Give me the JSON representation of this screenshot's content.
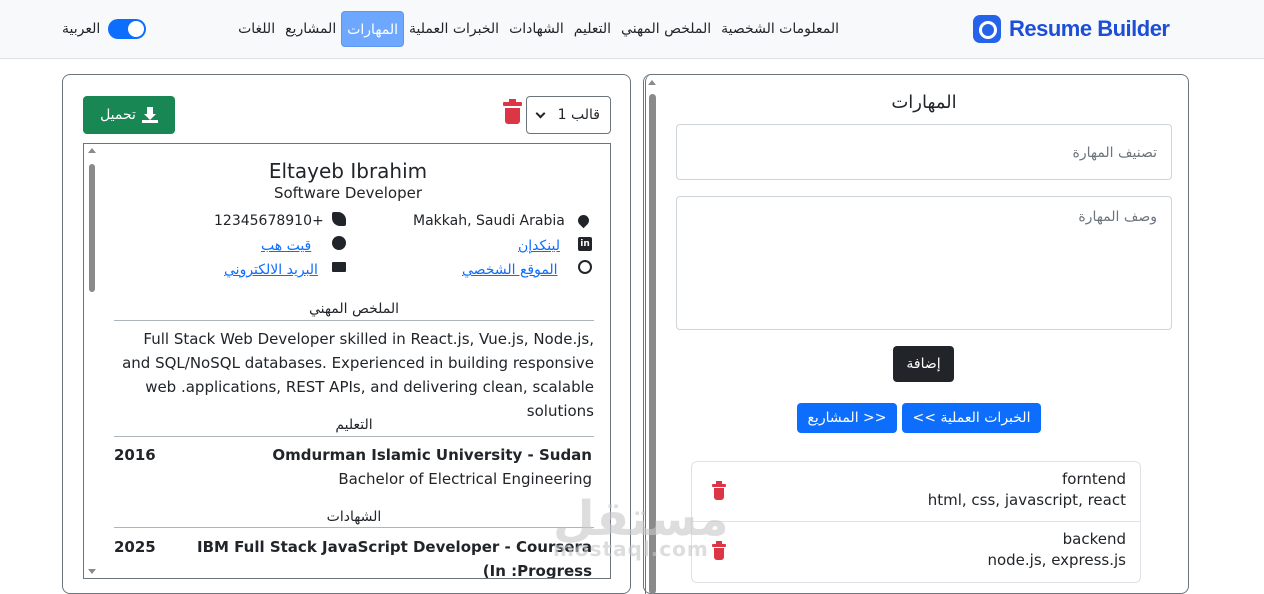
{
  "navbar": {
    "brand": "Resume Builder",
    "links": [
      {
        "label": "المعلومات الشخصية",
        "active": false
      },
      {
        "label": "الملخص المهني",
        "active": false
      },
      {
        "label": "التعليم",
        "active": false
      },
      {
        "label": "الشهادات",
        "active": false
      },
      {
        "label": "الخبرات العملية",
        "active": false
      },
      {
        "label": "المهارات",
        "active": true
      },
      {
        "label": "المشاريع",
        "active": false
      },
      {
        "label": "اللغات",
        "active": false
      }
    ],
    "language_label": "العربية",
    "accent_color": "#0d6efd"
  },
  "preview": {
    "download_label": "تحميل",
    "template_select_value": "قالب 1",
    "resume": {
      "name": "Eltayeb Ibrahim",
      "title": "Software Developer",
      "location": "Makkah, Saudi Arabia",
      "phone": "12345678910+",
      "linkedin": "لينكدإن",
      "github": "قيت هب",
      "website": "الموقع الشخصي",
      "email": "البريد الالكتروني",
      "summary_title": "الملخص المهني",
      "summary_text": "Full Stack Web Developer skilled in React.js, Vue.js, Node.js, and SQL/NoSQL databases. Experienced in building responsive web .applications, REST APIs, and delivering clean, scalable solutions",
      "education_title": "التعليم",
      "education": [
        {
          "school": "Omdurman Islamic University - Sudan",
          "degree": "Bachelor of Electrical Engineering",
          "year": "2016"
        }
      ],
      "certifications_title": "الشهادات",
      "certifications": [
        {
          "name": "IBM Full Stack JavaScript Developer - Coursera (In :Progress",
          "year": "2025"
        }
      ]
    }
  },
  "form": {
    "title": "المهارات",
    "category_placeholder": "تصنيف المهارة",
    "description_placeholder": "وصف المهارة",
    "add_label": "إضافة",
    "prev_label": "<< الخبرات العملية",
    "next_label": "المشاريع >>",
    "skills": [
      {
        "name": "forntend",
        "desc": "html, css, javascript, react"
      },
      {
        "name": "backend",
        "desc": "node.js, express.js"
      }
    ]
  },
  "watermark": {
    "arabic": "مستقل",
    "latin": "mostaql.com"
  }
}
